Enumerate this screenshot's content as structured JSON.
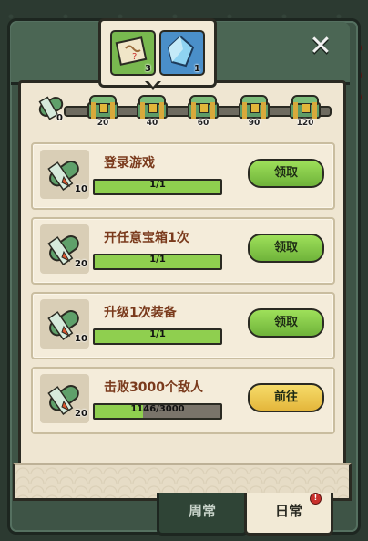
{
  "tooltip": {
    "rewards": [
      {
        "icon": "scroll-map-icon",
        "count": "3"
      },
      {
        "icon": "blue-crystal-icon",
        "count": "1"
      }
    ]
  },
  "activity": {
    "current_points": "0",
    "milestones": [
      "20",
      "40",
      "60",
      "90",
      "120"
    ]
  },
  "tasks": [
    {
      "title": "登录游戏",
      "reward": "10",
      "progress_text": "1/1",
      "progress": 1.0,
      "button": "领取",
      "button_style": "green"
    },
    {
      "title": "开任意宝箱1次",
      "reward": "20",
      "progress_text": "1/1",
      "progress": 1.0,
      "button": "领取",
      "button_style": "green"
    },
    {
      "title": "升级1次装备",
      "reward": "10",
      "progress_text": "1/1",
      "progress": 1.0,
      "button": "领取",
      "button_style": "green"
    },
    {
      "title": "击败3000个敌人",
      "reward": "20",
      "progress_text": "1146/3000",
      "progress": 0.382,
      "button": "前往",
      "button_style": "yellow"
    }
  ],
  "tabs": {
    "weekly": "周常",
    "daily": "日常"
  },
  "colors": {
    "accent_green": "#8fcf4f",
    "title_brown": "#7a3a1c",
    "panel_bg": "#efe6d2",
    "notification_red": "#c9302c"
  }
}
